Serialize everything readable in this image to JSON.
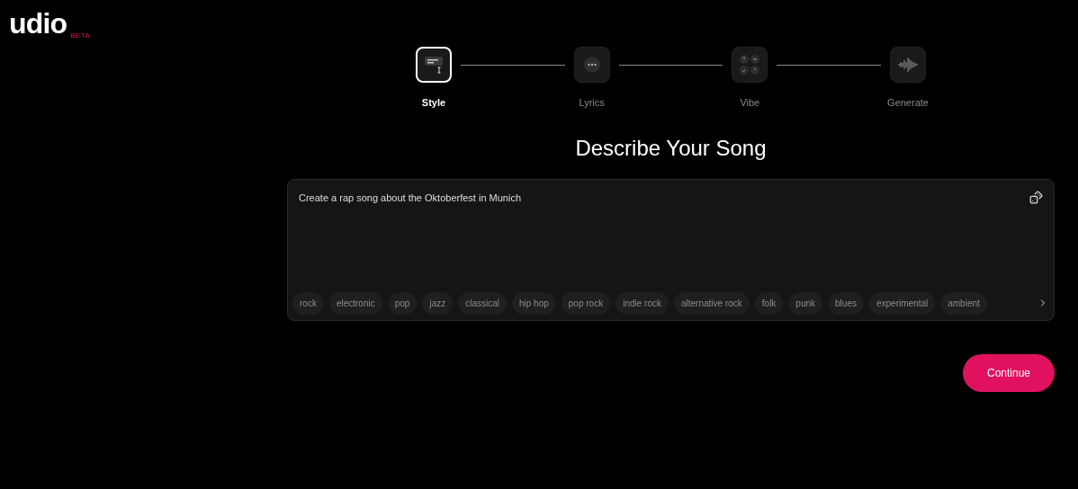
{
  "logo": {
    "wordmark": "udio",
    "badge": "BETA"
  },
  "steps": [
    {
      "label": "Style",
      "kind": "style",
      "selected": true
    },
    {
      "label": "Lyrics",
      "kind": "lyrics",
      "selected": false
    },
    {
      "label": "Vibe",
      "kind": "vibe",
      "selected": false
    },
    {
      "label": "Generate",
      "kind": "generate",
      "selected": false
    }
  ],
  "heading": "Describe Your Song",
  "prompt": {
    "value": "Create a rap song about the Oktoberfest in Munich"
  },
  "tags": [
    "rock",
    "electronic",
    "pop",
    "jazz",
    "classical",
    "hip hop",
    "pop rock",
    "indie rock",
    "alternative rock",
    "folk",
    "punk",
    "blues",
    "experimental",
    "ambient"
  ],
  "continue_button": "Continue"
}
